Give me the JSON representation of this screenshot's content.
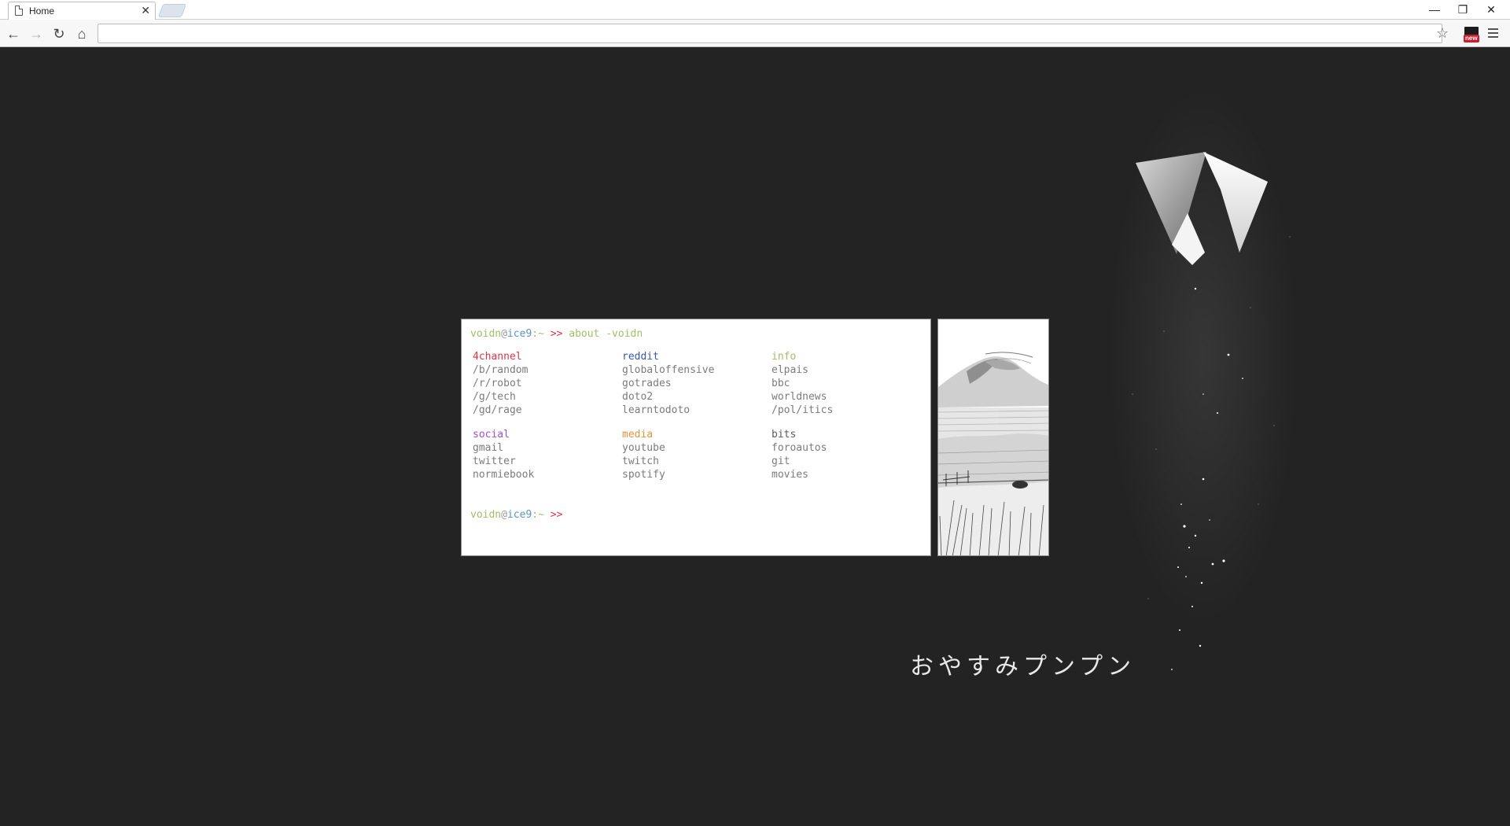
{
  "browser": {
    "tab_title": "Home",
    "tab_close": "✕",
    "window_controls": {
      "minimize": "—",
      "restore": "❐",
      "close": "✕"
    },
    "nav": {
      "back": "←",
      "forward": "→",
      "reload": "↻",
      "home": "⌂"
    },
    "address_value": "",
    "bookmark_icon": "☆",
    "extension_badge": "new"
  },
  "terminal": {
    "user": "voidn",
    "at": "@",
    "host": "ice9",
    "sep": ":~ ",
    "arrow": ">>",
    "command": "about -voidn",
    "sections": [
      {
        "title": "4channel",
        "color_class": "h-red",
        "links": [
          "/b/random",
          "/r/robot",
          "/g/tech",
          "/gd/rage"
        ]
      },
      {
        "title": "reddit",
        "color_class": "h-blue",
        "links": [
          "globaloffensive",
          "gotrades",
          "doto2",
          "learntodoto"
        ]
      },
      {
        "title": "info",
        "color_class": "h-green",
        "links": [
          "elpais",
          "bbc",
          "worldnews",
          "/pol/itics"
        ]
      },
      {
        "title": "social",
        "color_class": "h-purple",
        "links": [
          "gmail",
          "twitter",
          "normiebook"
        ]
      },
      {
        "title": "media",
        "color_class": "h-orange",
        "links": [
          "youtube",
          "twitch",
          "spotify"
        ]
      },
      {
        "title": "bits",
        "color_class": "h-gray",
        "links": [
          "foroautos",
          "git",
          "movies"
        ]
      }
    ]
  },
  "japanese_text": "おやすみプンプン",
  "colors": {
    "background": "#232323",
    "prompt_green": "#9fbf6a",
    "prompt_blue": "#5f93c0",
    "prompt_red": "#e0334b"
  }
}
